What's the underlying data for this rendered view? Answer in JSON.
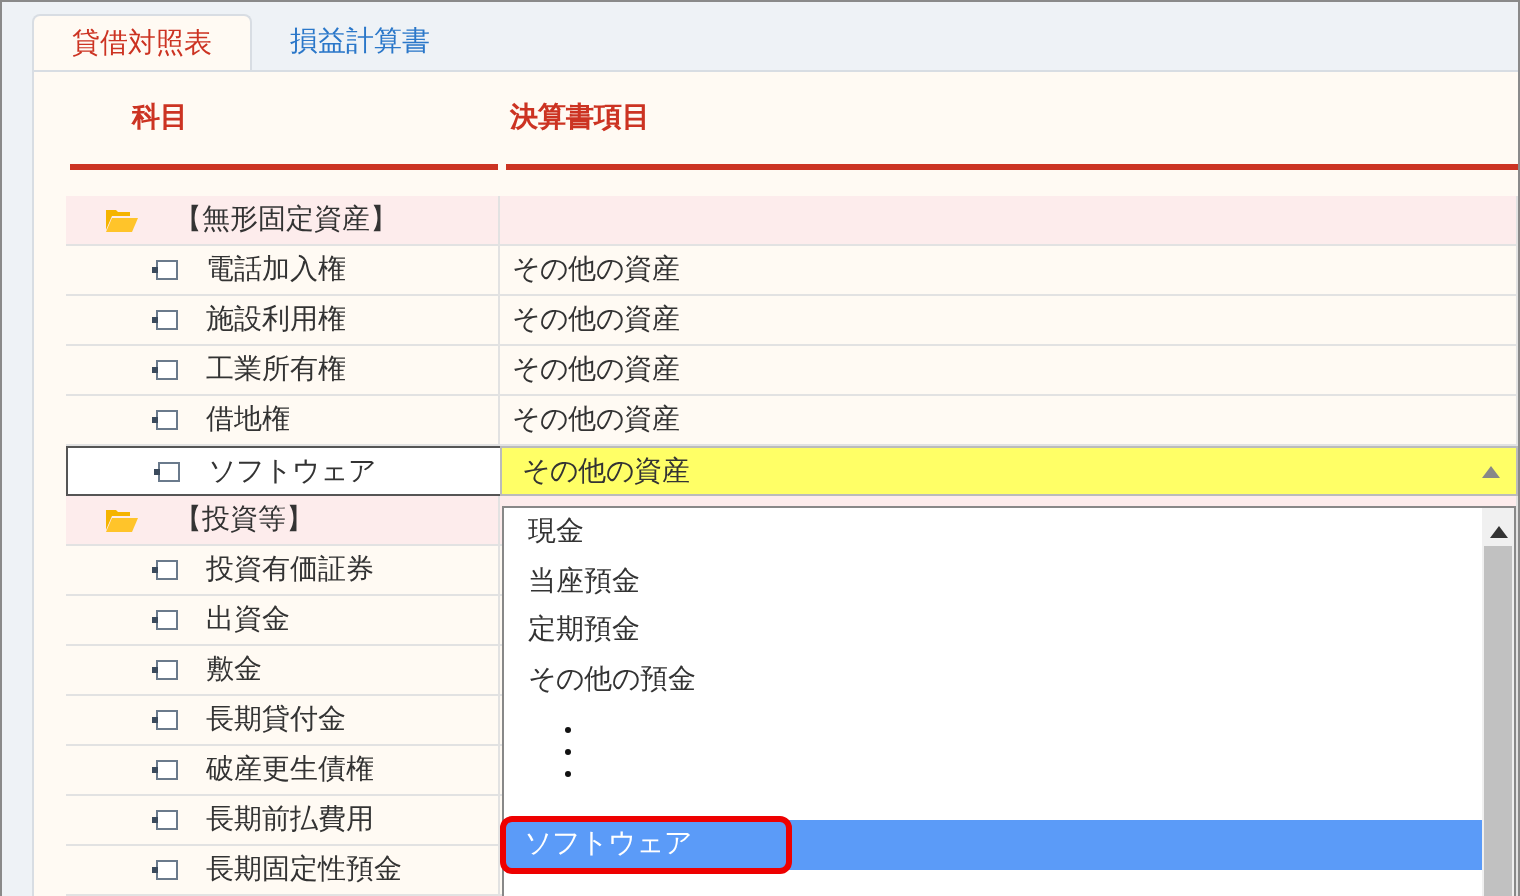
{
  "tabs": [
    {
      "label": "貸借対照表",
      "selected": true
    },
    {
      "label": "損益計算書",
      "selected": false
    }
  ],
  "columns": [
    "科目",
    "決算書項目"
  ],
  "groups": [
    {
      "label": "【無形固定資産】",
      "children": [
        {
          "label": "電話加入権",
          "value": "その他の資産",
          "selected": false
        },
        {
          "label": "施設利用権",
          "value": "その他の資産",
          "selected": false
        },
        {
          "label": "工業所有権",
          "value": "その他の資産",
          "selected": false
        },
        {
          "label": "借地権",
          "value": "その他の資産",
          "selected": false
        },
        {
          "label": "ソフトウェア",
          "value": "その他の資産",
          "selected": true
        }
      ]
    },
    {
      "label": "【投資等】",
      "children": [
        {
          "label": "投資有価証券",
          "selected": false
        },
        {
          "label": "出資金",
          "selected": false
        },
        {
          "label": "敷金",
          "selected": false
        },
        {
          "label": "長期貸付金",
          "selected": false
        },
        {
          "label": "破産更生債権",
          "selected": false
        },
        {
          "label": "長期前払費用",
          "selected": false
        },
        {
          "label": "長期固定性預金",
          "selected": false
        }
      ]
    }
  ],
  "dropdown": {
    "options": [
      {
        "kind": "option",
        "label": "現金",
        "selected": false,
        "annotated": false
      },
      {
        "kind": "option",
        "label": "当座預金",
        "selected": false,
        "annotated": false
      },
      {
        "kind": "option",
        "label": "定期預金",
        "selected": false,
        "annotated": false
      },
      {
        "kind": "option",
        "label": "その他の預金",
        "selected": false,
        "annotated": false
      },
      {
        "kind": "ellipsis"
      },
      {
        "kind": "option",
        "label": "ソフトウェア",
        "selected": true,
        "annotated": true
      }
    ]
  }
}
